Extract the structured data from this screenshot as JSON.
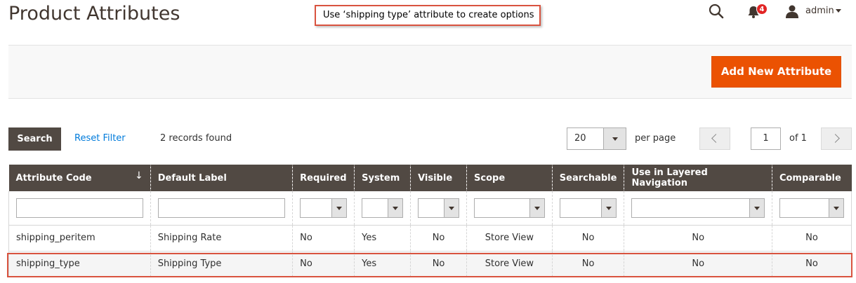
{
  "page": {
    "title": "Product Attributes",
    "callout": "Use ‘shipping type’ attribute to create options"
  },
  "header": {
    "notifications_count": "4",
    "user_name": "admin",
    "icons": [
      "search-icon",
      "bell-icon",
      "user-icon",
      "chevron-down-icon"
    ]
  },
  "actions": {
    "add_new_label": "Add New Attribute",
    "accent_color": "#eb5202"
  },
  "toolbar": {
    "search_label": "Search",
    "reset_label": "Reset Filter",
    "records_found": "2 records found",
    "per_page_value": "20",
    "per_page_label": "per page",
    "current_page": "1",
    "page_of": "of 1"
  },
  "grid": {
    "header_color": "#514943",
    "columns": [
      "Attribute Code",
      "Default Label",
      "Required",
      "System",
      "Visible",
      "Scope",
      "Searchable",
      "Use in Layered Navigation",
      "Comparable"
    ],
    "sort_indicator": "↓",
    "rows": [
      [
        "shipping_peritem",
        "Shipping Rate",
        "No",
        "Yes",
        "No",
        "Store View",
        "No",
        "No",
        "No"
      ],
      [
        "shipping_type",
        "Shipping Type",
        "No",
        "Yes",
        "No",
        "Store View",
        "No",
        "No",
        "No"
      ]
    ]
  }
}
